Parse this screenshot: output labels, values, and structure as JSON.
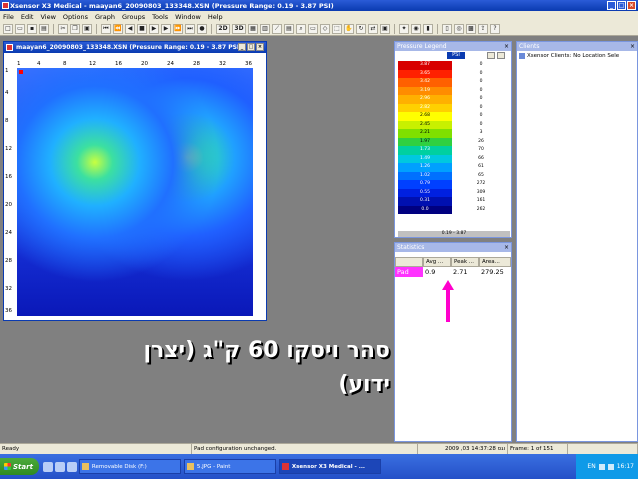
{
  "window": {
    "title": "Xsensor X3 Medical - maayan6_20090803_133348.XSN  (Pressure Range: 0.19 - 3.87 PSI)",
    "min": "_",
    "max": "□",
    "close": "×"
  },
  "menu": [
    "File",
    "Edit",
    "View",
    "Options",
    "Graph",
    "Groups",
    "Tools",
    "Window",
    "Help"
  ],
  "toolbar": {
    "view2d": "2D",
    "view3d": "3D"
  },
  "child_window": {
    "title": "maayan6_20090803_133348.XSN  (Pressure Range: 0.19 - 3.87 PSI)",
    "x_ticks": [
      "1",
      "4",
      "8",
      "12",
      "16",
      "20",
      "24",
      "28",
      "32",
      "36"
    ],
    "y_ticks": [
      "1",
      "4",
      "8",
      "12",
      "16",
      "20",
      "24",
      "28",
      "32",
      "36"
    ]
  },
  "pressure_legend": {
    "title": "Pressure Legend",
    "unit": "PSI",
    "levels": [
      {
        "value": "3.87",
        "color": "#d80000",
        "count": "0"
      },
      {
        "value": "3.65",
        "color": "#ff2000",
        "count": "0"
      },
      {
        "value": "3.42",
        "color": "#ff6000",
        "count": "0"
      },
      {
        "value": "3.19",
        "color": "#ff8c00",
        "count": "0"
      },
      {
        "value": "2.96",
        "color": "#ffb000",
        "count": "0"
      },
      {
        "value": "2.82",
        "color": "#ffd000",
        "count": "0"
      },
      {
        "value": "2.68",
        "color": "#ffff00",
        "count": "0"
      },
      {
        "value": "2.45",
        "color": "#c8f000",
        "count": "0"
      },
      {
        "value": "2.21",
        "color": "#80e000",
        "count": "3"
      },
      {
        "value": "1.97",
        "color": "#30d040",
        "count": "26"
      },
      {
        "value": "1.73",
        "color": "#00d0a0",
        "count": "70"
      },
      {
        "value": "1.49",
        "color": "#00c8e0",
        "count": "66"
      },
      {
        "value": "1.26",
        "color": "#00a0ff",
        "count": "61"
      },
      {
        "value": "1.02",
        "color": "#0070ff",
        "count": "65"
      },
      {
        "value": "0.79",
        "color": "#0040ff",
        "count": "272"
      },
      {
        "value": "0.55",
        "color": "#0020e0",
        "count": "309"
      },
      {
        "value": "0.31",
        "color": "#0010b0",
        "count": "161"
      },
      {
        "value": "0.0",
        "color": "#000080",
        "count": "262"
      }
    ],
    "range_label": "0.19 - 3.87"
  },
  "statistics": {
    "title": "Statistics",
    "columns": [
      "Avg ...",
      "Peak ...",
      "Area..."
    ],
    "rows": [
      {
        "name": "Pad",
        "avg": "0.9",
        "peak": "2.71",
        "area": "279.25"
      }
    ]
  },
  "clients": {
    "title": "Clients",
    "items": [
      "Xsensor Clients: No Location Sele"
    ]
  },
  "overlay": {
    "line1": "סהר ויסקו 60 ק\"ג (יצרן",
    "line2": "ידוע)",
    "arrow_color": "#ff00cc"
  },
  "statusbar": {
    "ready": "Ready",
    "message": "Pad configuration unchanged.",
    "datetime": "2009 ,03 וגס 14:37:28",
    "frame": "Frame: 1 of 151"
  },
  "taskbar": {
    "start": "Start",
    "tasks": [
      "Removable Disk (F:)",
      "5.JPG - Paint",
      "Xsensor X3 Medical - ..."
    ],
    "lang": "EN",
    "clock": "16:17"
  }
}
